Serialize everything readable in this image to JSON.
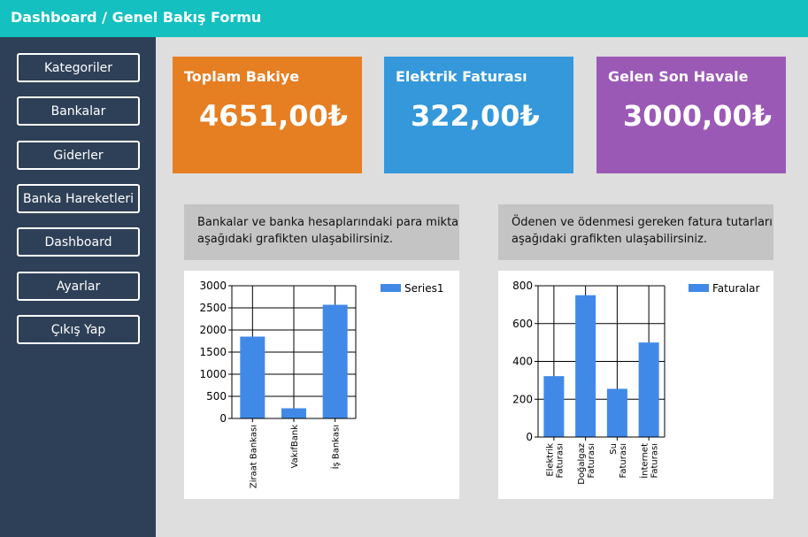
{
  "window": {
    "title": "Dashboard / Genel Bakış Formu"
  },
  "sidebar": {
    "items": [
      {
        "label": "Kategoriler"
      },
      {
        "label": "Bankalar"
      },
      {
        "label": "Giderler"
      },
      {
        "label": "Banka Hareketleri"
      },
      {
        "label": "Dashboard"
      },
      {
        "label": "Ayarlar"
      },
      {
        "label": "Çıkış Yap"
      }
    ]
  },
  "cards": [
    {
      "title": "Toplam Bakiye",
      "value": "4651,00₺",
      "color": "#e67e22"
    },
    {
      "title": "Elektrik Faturası",
      "value": "322,00₺",
      "color": "#3498db"
    },
    {
      "title": "Gelen Son Havale",
      "value": "3000,00₺",
      "color": "#9b59b6"
    }
  ],
  "descriptions": {
    "banks": {
      "line1": "Bankalar ve banka hesaplarındaki para miktarları",
      "line2": "aşağıdaki grafikten ulaşabilirsiniz."
    },
    "bills": {
      "line1": "Ödenen ve ödenmesi gereken fatura tutarlarına",
      "line2": "aşağıdaki grafikten ulaşabilirsiniz."
    }
  },
  "chart_data": [
    {
      "type": "bar",
      "categories": [
        "Ziraat Bankası",
        "VakıfBank",
        "İş Bankası"
      ],
      "series": [
        {
          "name": "Series1",
          "values": [
            1850,
            230,
            2570
          ],
          "color": "#4189e6"
        }
      ],
      "ylim": [
        0,
        3000
      ],
      "yticks": [
        0,
        500,
        1000,
        1500,
        2000,
        2500,
        3000
      ],
      "grid": true,
      "legend": "top-right"
    },
    {
      "type": "bar",
      "categories": [
        [
          "Elektrik",
          "Faturası"
        ],
        [
          "Doğalgaz",
          "Faturası"
        ],
        [
          "Su",
          "Faturası"
        ],
        [
          "İnternet",
          "Faturası"
        ]
      ],
      "series": [
        {
          "name": "Faturalar",
          "values": [
            322,
            750,
            255,
            500
          ],
          "color": "#4189e6"
        }
      ],
      "ylim": [
        0,
        800
      ],
      "yticks": [
        0,
        200,
        400,
        600,
        800
      ],
      "grid": true,
      "legend": "top-right"
    }
  ]
}
